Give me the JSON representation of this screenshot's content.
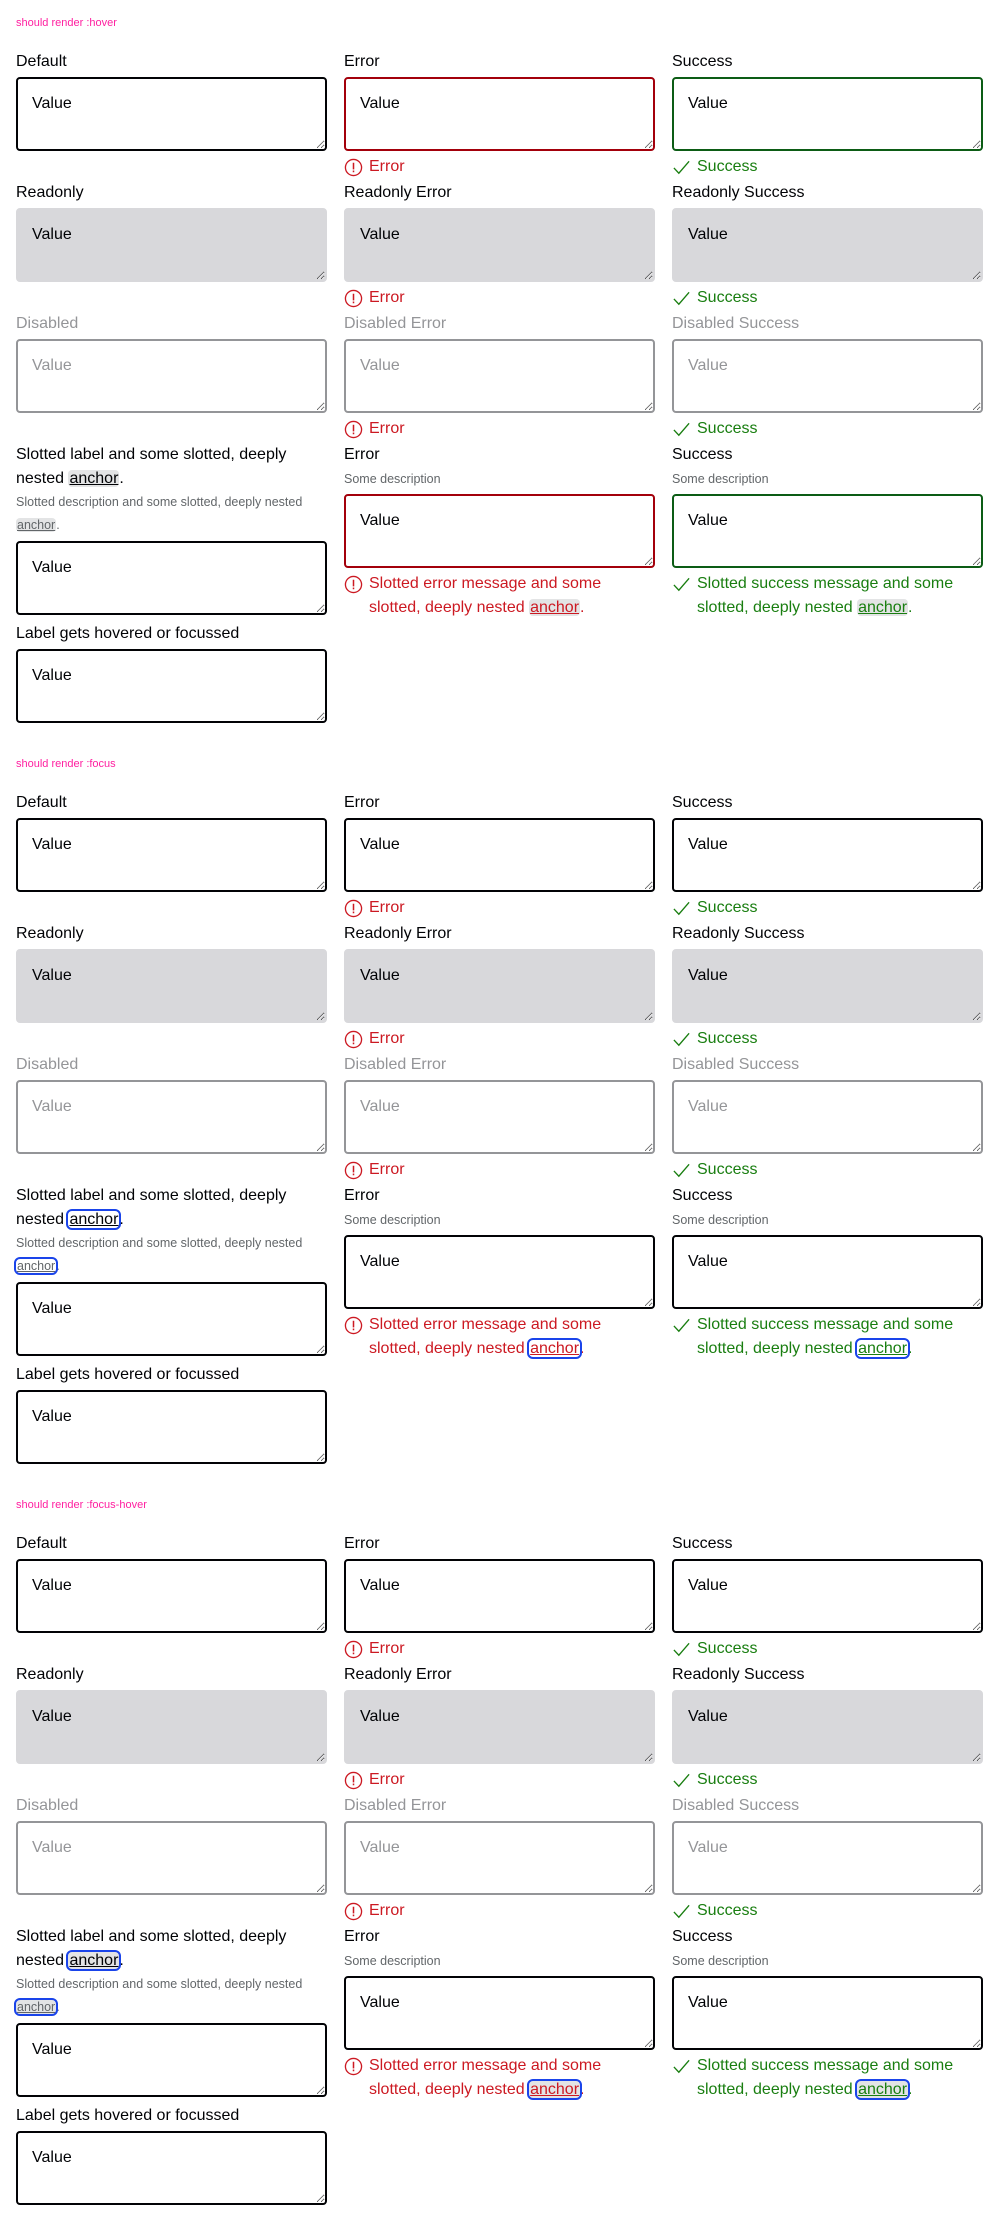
{
  "colors": {
    "title": "#ff1fa0",
    "error": "#cc1922",
    "success": "#197e10",
    "focus": "#1a44ea",
    "readonly_bg": "#d8d8db",
    "disabled": "#949598"
  },
  "sections": [
    {
      "title": "should render :hover",
      "state": "hover"
    },
    {
      "title": "should render :focus",
      "state": "focus"
    },
    {
      "title": "should render :focus-hover",
      "state": "focus-hover"
    }
  ],
  "value": "Value",
  "fields": [
    {
      "label": "Default",
      "type": "default"
    },
    {
      "label": "Error",
      "type": "error",
      "message": "Error"
    },
    {
      "label": "Success",
      "type": "success",
      "message": "Success"
    },
    {
      "label": "Readonly",
      "type": "readonly"
    },
    {
      "label": "Readonly Error",
      "type": "readonly error",
      "message": "Error"
    },
    {
      "label": "Readonly Success",
      "type": "readonly success",
      "message": "Success"
    },
    {
      "label": "Disabled",
      "type": "disabled"
    },
    {
      "label": "Disabled Error",
      "type": "disabled error",
      "message": "Error"
    },
    {
      "label": "Disabled Success",
      "type": "disabled success",
      "message": "Success"
    },
    {
      "label_slotted": {
        "text": "Slotted label and some slotted, deeply nested ",
        "anchor": "anchor",
        "end": "."
      },
      "desc_slotted": {
        "text": "Slotted description and some slotted, deeply nested ",
        "anchor": "anchor",
        "end": "."
      },
      "type": "default"
    },
    {
      "label": "Error",
      "description": "Some description",
      "type": "error",
      "message_slotted": {
        "text": "Slotted error message and some slotted, deeply nested ",
        "anchor": "anchor",
        "end": "."
      }
    },
    {
      "label": "Success",
      "description": "Some description",
      "type": "success",
      "message_slotted": {
        "text": "Slotted success message and some slotted, deeply nested ",
        "anchor": "anchor",
        "end": "."
      }
    },
    {
      "label": "Label gets hovered or focussed",
      "type": "default"
    }
  ],
  "icons": {
    "error": "exclamation-circle-icon",
    "success": "checkmark-icon"
  }
}
